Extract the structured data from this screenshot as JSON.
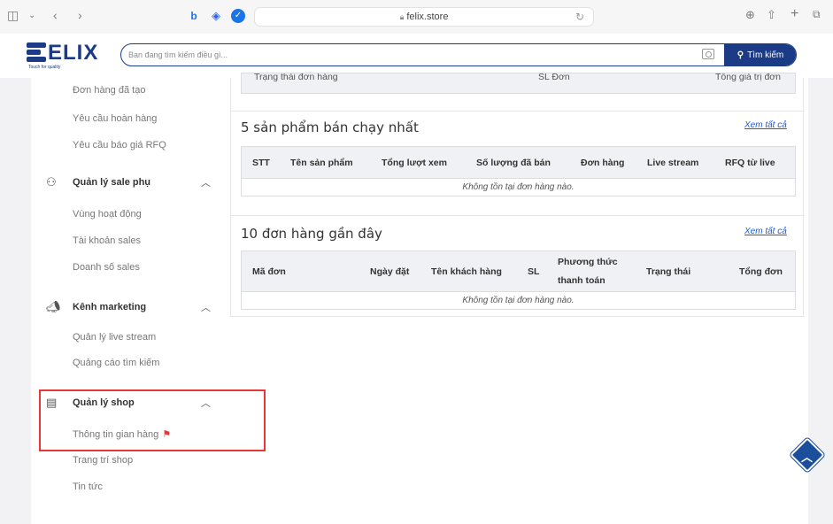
{
  "browser": {
    "url": "felix.store"
  },
  "header": {
    "brand": "ELIX",
    "tagline": "Touch for quality",
    "search_placeholder": "Ban đang tìm kiếm điều gì...",
    "search_button": "Tìm kiếm"
  },
  "sidebar": {
    "top_items": [
      "Đơn hàng đã tạo",
      "Yêu cầu hoàn hàng",
      "Yêu cầu báo giá RFQ"
    ],
    "groups": [
      {
        "label": "Quản lý sale phụ",
        "icon": "users-icon",
        "items": [
          "Vùng hoạt động",
          "Tài khoản sales",
          "Doanh số sales"
        ]
      },
      {
        "label": "Kênh marketing",
        "icon": "megaphone-icon",
        "items": [
          "Quản lý live stream",
          "Quảng cáo tìm kiếm"
        ]
      },
      {
        "label": "Quản lý shop",
        "icon": "store-icon",
        "items": [
          "Thông tin gian hàng",
          "Trang trí shop",
          "Tin tức"
        ]
      }
    ]
  },
  "top_table": {
    "headers_partial": [
      "Trạng thái đơn hàng",
      "SL Đơn",
      "Tổng giá trị đơn"
    ]
  },
  "best_sellers": {
    "title": "5 sản phẩm bán chạy nhất",
    "see_all": "Xem tất cả",
    "headers": [
      "STT",
      "Tên sản phẩm",
      "Tổng lượt xem",
      "Số lượng đã bán",
      "Đơn hàng",
      "Live stream",
      "RFQ từ live"
    ],
    "empty": "Không tồn tại đơn hàng nào."
  },
  "recent_orders": {
    "title": "10 đơn hàng gần đây",
    "see_all": "Xem tất cả",
    "headers": [
      "Mã đơn",
      "Ngày đặt",
      "Tên khách hàng",
      "SL",
      "Phương thức",
      "thanh toán",
      "Trạng thái",
      "Tổng đơn"
    ],
    "empty": "Không tồn tại đơn hàng nào."
  },
  "colors": {
    "brand": "#1b3b87",
    "highlight": "#e53935",
    "link": "#1e5bd8"
  }
}
